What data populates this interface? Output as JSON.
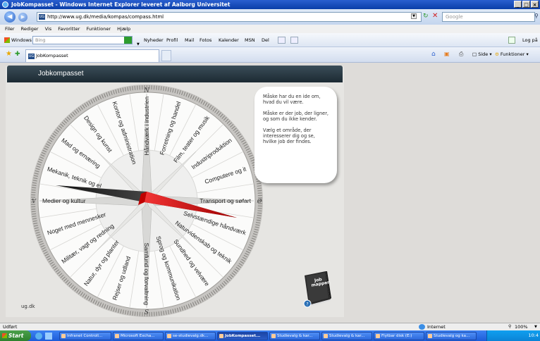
{
  "window": {
    "title": "JobKompasset - Windows Internet Explorer leveret af Aalborg Universitet",
    "controls": [
      "_",
      "□",
      "×"
    ]
  },
  "address": {
    "url": "http://www.ug.dk/media/kompas/compass.html",
    "search_placeholder": "Google"
  },
  "menu": [
    "Filer",
    "Rediger",
    "Vis",
    "Favoritter",
    "Funktioner",
    "Hjælp"
  ],
  "links_toolbar": {
    "windows_live": "Windows Live",
    "bing_placeholder": "Bing",
    "links": [
      "Nyheder",
      "Profil",
      "Mail",
      "Fotos",
      "Kalender",
      "MSN",
      "Del"
    ],
    "login": "Log på"
  },
  "tab": {
    "label": "JobKompasset"
  },
  "command_bar": {
    "side": "Side",
    "funktioner": "Funktioner"
  },
  "page": {
    "header": "Jobkompasset",
    "bubble": [
      "Måske har du en ide om, hvad du vil være.",
      "Måske er der job, der ligner, og som du ikke kender.",
      "Vælg et område, der interesserer dig og se, hvilke job der findes."
    ],
    "footer": "ug.dk",
    "book_label": "Job mappen",
    "compass_north": "N",
    "compass_south": "S",
    "compass_west": "V",
    "compass_east": "Ø",
    "sectors": [
      {
        "label": "Håndværk i industrien"
      },
      {
        "label": "Forretning og handel"
      },
      {
        "label": "Film, teater og musik"
      },
      {
        "label": "Industriproduktion"
      },
      {
        "label": "Computere og it"
      },
      {
        "label": "Transport og søfart"
      },
      {
        "label": "Selvstændige håndværk"
      },
      {
        "label": "Naturvidenskab og teknik"
      },
      {
        "label": "Sundhed og velvære"
      },
      {
        "label": "Sprog og kommunikation"
      },
      {
        "label": "Samfund og forvaltning"
      },
      {
        "label": "Rejser og udland"
      },
      {
        "label": "Natur, dyr og planter"
      },
      {
        "label": "Militær, vagt og redning"
      },
      {
        "label": "Noget med mennesker"
      },
      {
        "label": "Medier og kultur"
      },
      {
        "label": "Mekanik, teknik og el"
      },
      {
        "label": "Mad og ernæring"
      },
      {
        "label": "Design og kunst"
      },
      {
        "label": "Kontor og administration"
      }
    ]
  },
  "status": {
    "left": "Udført",
    "zone": "Internet",
    "zoom": "100%"
  },
  "taskbar": {
    "start": "Start",
    "tasks": [
      {
        "label": "Infranet Controll..."
      },
      {
        "label": "Microsoft Excha..."
      },
      {
        "label": "se-studievalg.dk..."
      },
      {
        "label": "JobKompasset...",
        "active": true
      },
      {
        "label": "Studievalg & kar..."
      },
      {
        "label": "Studievalg & kar..."
      },
      {
        "label": "Flytbar disk (E:)"
      },
      {
        "label": "Studievalg og ka..."
      }
    ],
    "clock": "10:4"
  }
}
